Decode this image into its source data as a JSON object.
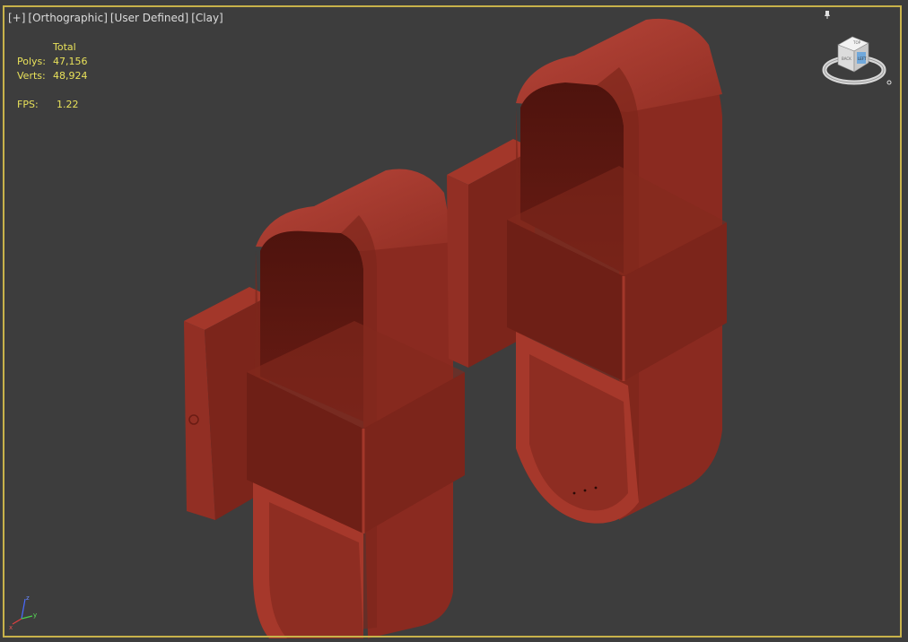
{
  "viewport": {
    "label": {
      "plus": "[+]",
      "projection": "[Orthographic]",
      "view": "[User Defined]",
      "shading": "[Clay]"
    },
    "stats": {
      "header": "Total",
      "polys_label": "Polys:",
      "polys_value": "47,156",
      "verts_label": "Verts:",
      "verts_value": "48,924",
      "fps_label": "FPS:",
      "fps_value": "1.22"
    },
    "viewcube": {
      "face_top": "TOP",
      "face_front": "BACK",
      "face_right": "LEFT"
    },
    "axis": {
      "x": "x",
      "y": "y",
      "z": "z"
    },
    "colors": {
      "background": "#3d3d3d",
      "active_border": "#c8b24a",
      "stats_text": "#e8e15a",
      "label_text": "#dcdcdc",
      "clay": "#8a2a20"
    },
    "icons": [
      "pin-icon",
      "viewcube-icon",
      "axis-tripod-icon"
    ]
  }
}
